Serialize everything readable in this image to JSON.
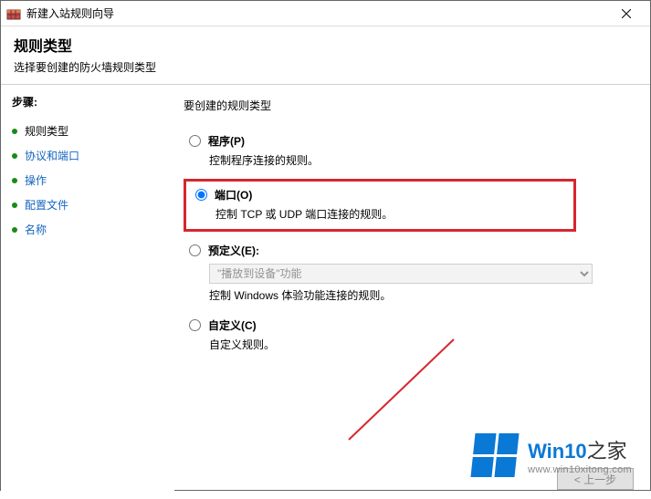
{
  "window": {
    "title": "新建入站规则向导"
  },
  "header": {
    "title": "规则类型",
    "subtitle": "选择要创建的防火墙规则类型"
  },
  "sidebar": {
    "steps_label": "步骤:",
    "items": [
      {
        "label": "规则类型",
        "current": true
      },
      {
        "label": "协议和端口",
        "current": false
      },
      {
        "label": "操作",
        "current": false
      },
      {
        "label": "配置文件",
        "current": false
      },
      {
        "label": "名称",
        "current": false
      }
    ]
  },
  "main": {
    "prompt": "要创建的规则类型",
    "options": {
      "program": {
        "label": "程序(P)",
        "desc": "控制程序连接的规则。"
      },
      "port": {
        "label": "端口(O)",
        "desc": "控制 TCP 或 UDP 端口连接的规则。"
      },
      "predef": {
        "label": "预定义(E):",
        "desc": "控制 Windows 体验功能连接的规则。",
        "dropdown_value": "\"播放到设备\"功能"
      },
      "custom": {
        "label": "自定义(C)",
        "desc": "自定义规则。"
      }
    }
  },
  "buttons": {
    "back": "< 上一步"
  },
  "watermark": {
    "brand_main": "Win10",
    "brand_suffix": "之家",
    "url": "www.win10xitong.com"
  }
}
